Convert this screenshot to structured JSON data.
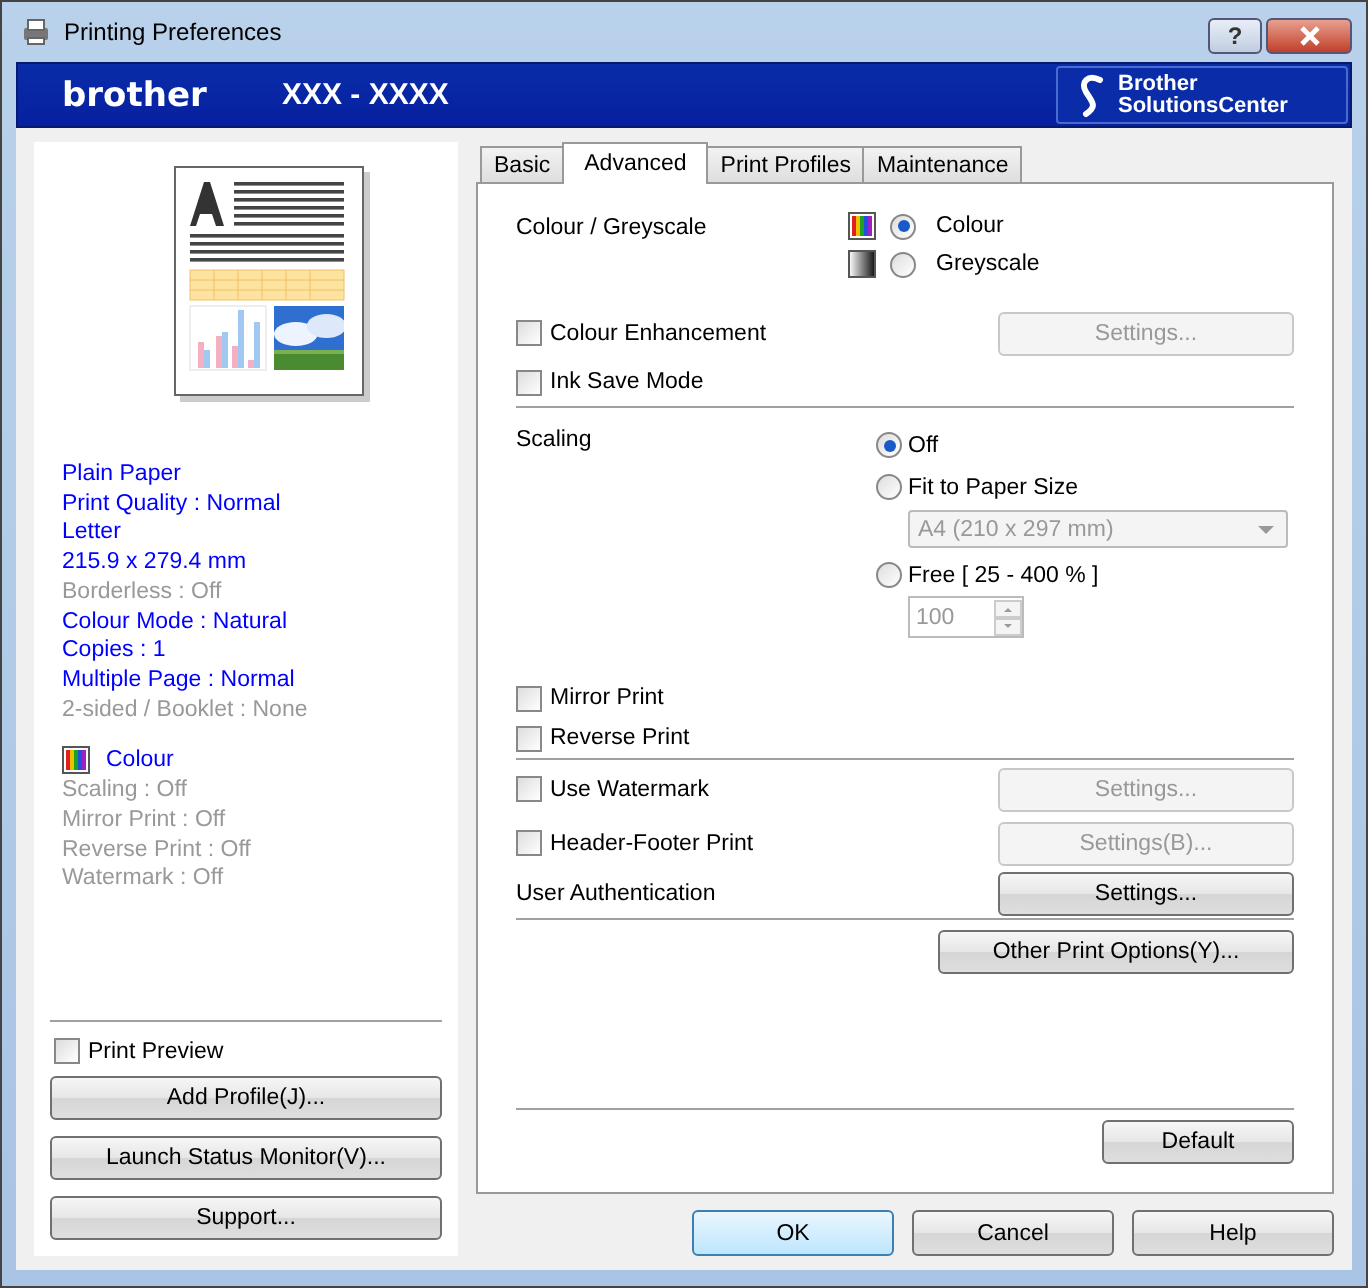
{
  "window": {
    "title": "Printing Preferences",
    "help": "?"
  },
  "header": {
    "brand": "brother",
    "model": "XXX - XXXX",
    "solutions_center": [
      "Brother",
      "SolutionsCenter"
    ]
  },
  "summary": [
    {
      "text": "Plain Paper",
      "active": true
    },
    {
      "text": "Print Quality : Normal",
      "active": true
    },
    {
      "text": "Letter",
      "active": true
    },
    {
      "text": "215.9 x 279.4 mm",
      "active": true
    },
    {
      "text": "Borderless : Off",
      "active": false
    },
    {
      "text": "Colour Mode : Natural",
      "active": true
    },
    {
      "text": "Copies : 1",
      "active": true
    },
    {
      "text": "Multiple Page : Normal",
      "active": true
    },
    {
      "text": "2-sided / Booklet : None",
      "active": false
    }
  ],
  "summary_colour": {
    "text": "Colour",
    "active": true
  },
  "summary_options": [
    {
      "text": "Scaling : Off",
      "active": false
    },
    {
      "text": "Mirror Print : Off",
      "active": false
    },
    {
      "text": "Reverse Print : Off",
      "active": false
    },
    {
      "text": "Watermark : Off",
      "active": false
    }
  ],
  "print_preview": {
    "label": "Print Preview",
    "checked": false
  },
  "side_buttons": [
    "Add Profile(J)...",
    "Launch Status Monitor(V)...",
    "Support..."
  ],
  "tabs": [
    {
      "label": "Basic",
      "selected": false
    },
    {
      "label": "Advanced",
      "selected": true
    },
    {
      "label": "Print Profiles",
      "selected": false
    },
    {
      "label": "Maintenance",
      "selected": false
    }
  ],
  "colour_greyscale": {
    "label": "Colour / Greyscale",
    "options": [
      {
        "label": "Colour",
        "selected": true,
        "kind": "colour"
      },
      {
        "label": "Greyscale",
        "selected": false,
        "kind": "greyscale"
      }
    ]
  },
  "colour_enhancement": {
    "label": "Colour Enhancement",
    "checked": false,
    "settings": {
      "label": "Settings...",
      "disabled": true
    }
  },
  "ink_save_mode": {
    "label": "Ink Save Mode",
    "checked": false
  },
  "scaling": {
    "label": "Scaling",
    "options": [
      {
        "label": "Off",
        "selected": true,
        "kind": "plain"
      },
      {
        "label": "Fit to Paper Size",
        "selected": false,
        "kind": "dropdown"
      },
      {
        "label": "Free [ 25 - 400 % ]",
        "selected": false,
        "kind": "spinner"
      }
    ],
    "paper_size": {
      "value": "A4 (210 x 297 mm)",
      "disabled": true
    },
    "free_value": {
      "value": "100",
      "disabled": true
    }
  },
  "mirror_print": {
    "label": "Mirror Print",
    "checked": false
  },
  "reverse_print": {
    "label": "Reverse Print",
    "checked": false
  },
  "use_watermark": {
    "label": "Use Watermark",
    "checked": false,
    "settings": {
      "label": "Settings...",
      "disabled": true
    }
  },
  "header_footer_print": {
    "label": "Header-Footer Print",
    "checked": false,
    "settings": {
      "label": "Settings(B)...",
      "disabled": true
    }
  },
  "user_authentication": {
    "label": "User Authentication",
    "settings": {
      "label": "Settings...",
      "disabled": false
    }
  },
  "other_print_options": "Other Print Options(Y)...",
  "default_button": "Default",
  "dialog_buttons": [
    {
      "label": "OK",
      "default": true
    },
    {
      "label": "Cancel",
      "default": false
    },
    {
      "label": "Help",
      "default": false
    }
  ]
}
